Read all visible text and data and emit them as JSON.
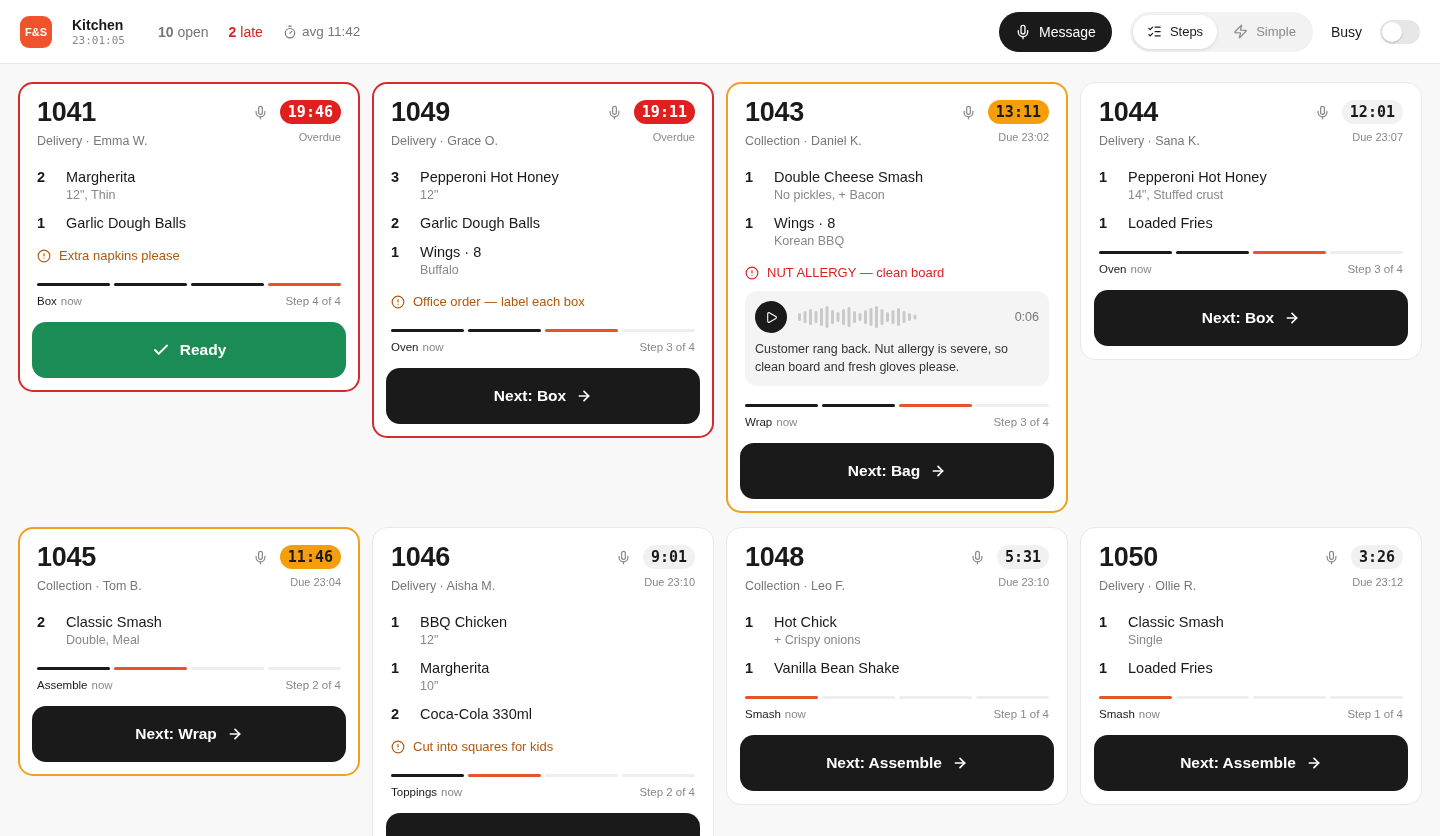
{
  "header": {
    "logo": "F&S",
    "title": "Kitchen",
    "clock": "23:01:05",
    "stats": [
      {
        "kind": "count",
        "text": "**10** open"
      },
      {
        "kind": "late",
        "text": "**2** late"
      },
      {
        "kind": "avg",
        "text": "avg 11:42"
      }
    ],
    "message_button": "Message",
    "view_modes": [
      {
        "kind": "steps",
        "label": "Steps",
        "selected": true
      },
      {
        "kind": "simple",
        "label": "Simple",
        "selected": false
      }
    ],
    "busy": {
      "label": "Busy",
      "on": false
    }
  },
  "orders": [
    {
      "kind": "overdue",
      "number": "1041",
      "meta": "Delivery · Emma W.",
      "timer": "19:46",
      "due": "Overdue",
      "items": [
        {
          "qty": "2",
          "name": "Margherita",
          "note": "12\", Thin"
        },
        {
          "qty": "1",
          "name": "Garlic Dough Balls"
        }
      ],
      "alert": {
        "kind": "note",
        "text": "Extra napkins please"
      },
      "steps": [
        {
          "kind": "done"
        },
        {
          "kind": "done"
        },
        {
          "kind": "done"
        },
        {
          "kind": "current"
        }
      ],
      "stage": "Box",
      "stage_time": "now",
      "step_label": "Step 4 of 4",
      "action": {
        "kind": "ready",
        "label": "Ready"
      }
    },
    {
      "kind": "overdue",
      "number": "1049",
      "meta": "Delivery · Grace O.",
      "timer": "19:11",
      "due": "Overdue",
      "items": [
        {
          "qty": "3",
          "name": "Pepperoni Hot Honey",
          "note": "12\""
        },
        {
          "qty": "2",
          "name": "Garlic Dough Balls"
        },
        {
          "qty": "1",
          "name": "Wings · 8",
          "note": "Buffalo"
        }
      ],
      "alert": {
        "kind": "note",
        "text": "Office order — label each box"
      },
      "steps": [
        {
          "kind": "done"
        },
        {
          "kind": "done"
        },
        {
          "kind": "current"
        },
        {
          "kind": "todo"
        }
      ],
      "stage": "Oven",
      "stage_time": "now",
      "step_label": "Step 3 of 4",
      "action": {
        "kind": "next",
        "label": "Next: Box"
      }
    },
    {
      "kind": "soon",
      "number": "1043",
      "meta": "Collection · Daniel K.",
      "timer": "13:11",
      "due": "Due 23:02",
      "items": [
        {
          "qty": "1",
          "name": "Double Cheese Smash",
          "note": "No pickles, + Bacon"
        },
        {
          "qty": "1",
          "name": "Wings · 8",
          "note": "Korean BBQ"
        }
      ],
      "alert": {
        "kind": "allergy",
        "text": "NUT ALLERGY — clean board"
      },
      "voice_message": {
        "duration": "0:06",
        "transcript": "Customer rang back. Nut allergy is severe, so clean board and fresh gloves please."
      },
      "steps": [
        {
          "kind": "done"
        },
        {
          "kind": "done"
        },
        {
          "kind": "current"
        },
        {
          "kind": "todo"
        }
      ],
      "stage": "Wrap",
      "stage_time": "now",
      "step_label": "Step 3 of 4",
      "action": {
        "kind": "next",
        "label": "Next: Bag"
      }
    },
    {
      "kind": "normal",
      "number": "1044",
      "meta": "Delivery · Sana K.",
      "timer": "12:01",
      "due": "Due 23:07",
      "items": [
        {
          "qty": "1",
          "name": "Pepperoni Hot Honey",
          "note": "14\", Stuffed crust"
        },
        {
          "qty": "1",
          "name": "Loaded Fries"
        }
      ],
      "steps": [
        {
          "kind": "done"
        },
        {
          "kind": "done"
        },
        {
          "kind": "current"
        },
        {
          "kind": "todo"
        }
      ],
      "stage": "Oven",
      "stage_time": "now",
      "step_label": "Step 3 of 4",
      "action": {
        "kind": "next",
        "label": "Next: Box"
      }
    },
    {
      "kind": "soon",
      "number": "1045",
      "meta": "Collection · Tom B.",
      "timer": "11:46",
      "due": "Due 23:04",
      "items": [
        {
          "qty": "2",
          "name": "Classic Smash",
          "note": "Double, Meal"
        }
      ],
      "steps": [
        {
          "kind": "done"
        },
        {
          "kind": "current"
        },
        {
          "kind": "todo"
        },
        {
          "kind": "todo"
        }
      ],
      "stage": "Assemble",
      "stage_time": "now",
      "step_label": "Step 2 of 4",
      "action": {
        "kind": "next",
        "label": "Next: Wrap"
      }
    },
    {
      "kind": "normal",
      "number": "1046",
      "meta": "Delivery · Aisha M.",
      "timer": "9:01",
      "due": "Due 23:10",
      "items": [
        {
          "qty": "1",
          "name": "BBQ Chicken",
          "note": "12\""
        },
        {
          "qty": "1",
          "name": "Margherita",
          "note": "10\""
        },
        {
          "qty": "2",
          "name": "Coca-Cola 330ml"
        }
      ],
      "alert": {
        "kind": "note",
        "text": "Cut into squares for kids"
      },
      "steps": [
        {
          "kind": "done"
        },
        {
          "kind": "current"
        },
        {
          "kind": "todo"
        },
        {
          "kind": "todo"
        }
      ],
      "stage": "Toppings",
      "stage_time": "now",
      "step_label": "Step 2 of 4",
      "action": {
        "kind": "next"
      }
    },
    {
      "kind": "normal",
      "number": "1048",
      "meta": "Collection · Leo F.",
      "timer": "5:31",
      "due": "Due 23:10",
      "items": [
        {
          "qty": "1",
          "name": "Hot Chick",
          "note": "+ Crispy onions"
        },
        {
          "qty": "1",
          "name": "Vanilla Bean Shake"
        }
      ],
      "steps": [
        {
          "kind": "current"
        },
        {
          "kind": "todo"
        },
        {
          "kind": "todo"
        },
        {
          "kind": "todo"
        }
      ],
      "stage": "Smash",
      "stage_time": "now",
      "step_label": "Step 1 of 4",
      "action": {
        "kind": "next",
        "label": "Next: Assemble"
      }
    },
    {
      "kind": "normal",
      "number": "1050",
      "meta": "Delivery · Ollie R.",
      "timer": "3:26",
      "due": "Due 23:12",
      "items": [
        {
          "qty": "1",
          "name": "Classic Smash",
          "note": "Single"
        },
        {
          "qty": "1",
          "name": "Loaded Fries"
        }
      ],
      "steps": [
        {
          "kind": "current"
        },
        {
          "kind": "todo"
        },
        {
          "kind": "todo"
        },
        {
          "kind": "todo"
        }
      ],
      "stage": "Smash",
      "stage_time": "now",
      "step_label": "Step 1 of 4",
      "action": {
        "kind": "next",
        "label": "Next: Assemble"
      }
    }
  ]
}
